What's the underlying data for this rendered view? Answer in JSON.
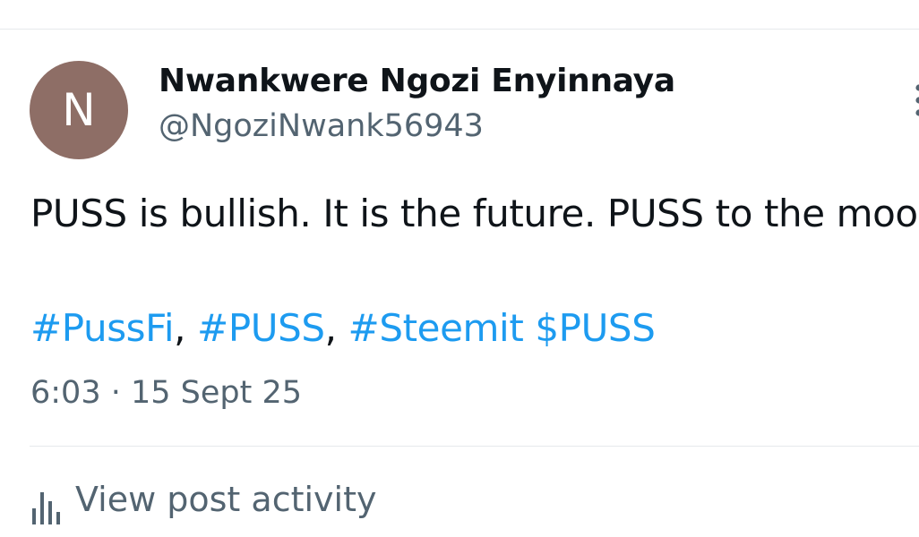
{
  "post": {
    "author": {
      "avatar_initial": "N",
      "avatar_color": "#8e6e66",
      "display_name": "Nwankwere Ngozi Enyinnaya",
      "handle": "@NgoziNwank56943"
    },
    "more_icon": "more-vertical-icon",
    "text": "PUSS is bullish. It is the future. PUSS to the moon",
    "hashtags": [
      {
        "text": "#PussFi"
      },
      {
        "separator": ", "
      },
      {
        "text": "#PUSS"
      },
      {
        "separator": ", "
      },
      {
        "text": "#Steemit $PUSS"
      }
    ],
    "timestamp": "6:03 · 15 Sept 25",
    "activity": {
      "icon": "analytics-icon",
      "label": "View post activity"
    },
    "link_color": "#1d9bf0"
  }
}
